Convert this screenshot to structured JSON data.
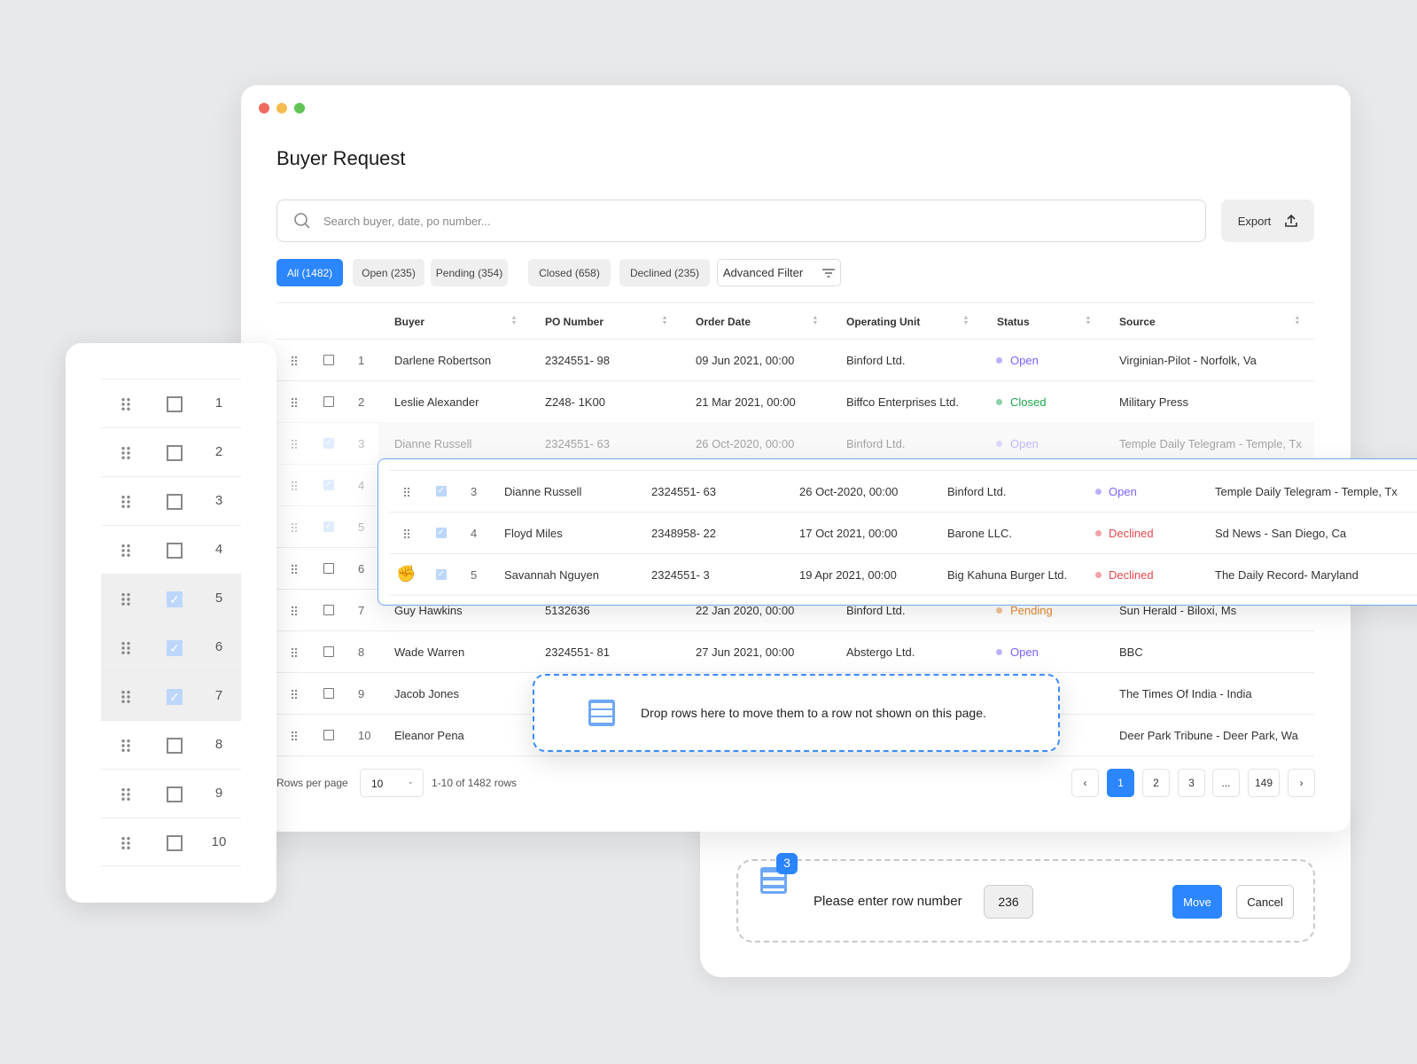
{
  "window": {
    "title": "Buyer Request",
    "traffic_colors": [
      "#ee6a5f",
      "#f5bd4f",
      "#61c454"
    ]
  },
  "search": {
    "placeholder": "Search buyer, date, po number..."
  },
  "export_label": "Export",
  "filters": [
    {
      "label": "All (1482)",
      "active": true
    },
    {
      "label": "Open (235)"
    },
    {
      "label": "Pending (354)"
    },
    {
      "label": "Closed (658)"
    },
    {
      "label": "Declined (235)"
    }
  ],
  "advanced_filter": "Advanced Filter",
  "columns": [
    "Buyer",
    "PO Number",
    "Order Date",
    "Operating Unit",
    "Status",
    "Source"
  ],
  "status_colors": {
    "Open": "#7b61ff",
    "Closed": "#1aa64a",
    "Declined": "#e5484d",
    "Pending": "#e08a2e"
  },
  "rows": [
    {
      "n": "1",
      "buyer": "Darlene Robertson",
      "po": "2324551- 98",
      "date": "09 Jun 2021, 00:00",
      "unit": "Binford Ltd.",
      "status": "Open",
      "source": "Virginian-Pilot - Norfolk, Va",
      "checked": false
    },
    {
      "n": "2",
      "buyer": "Leslie Alexander",
      "po": "Z248- 1K00",
      "date": "21 Mar 2021, 00:00",
      "unit": "Biffco Enterprises Ltd.",
      "status": "Closed",
      "source": "Military Press",
      "checked": false
    },
    {
      "n": "3",
      "buyer": "Dianne Russell",
      "po": "2324551- 63",
      "date": "26 Oct-2020, 00:00",
      "unit": "Binford Ltd.",
      "status": "Open",
      "source": "Temple Daily Telegram - Temple, Tx",
      "checked": true
    },
    {
      "n": "4",
      "checked": true
    },
    {
      "n": "5",
      "checked": true
    },
    {
      "n": "6",
      "checked": false
    },
    {
      "n": "7",
      "buyer": "Guy Hawkins",
      "po": "5132636",
      "date": "22 Jan 2020, 00:00",
      "unit": "Binford Ltd.",
      "status": "Pending",
      "source": "Sun Herald - Biloxi, Ms",
      "checked": false
    },
    {
      "n": "8",
      "buyer": "Wade Warren",
      "po": "2324551- 81",
      "date": "27 Jun 2021, 00:00",
      "unit": "Abstergo Ltd.",
      "status": "Open",
      "source": "BBC",
      "checked": false
    },
    {
      "n": "9",
      "buyer": "Jacob Jones",
      "source": "The Times Of India - India",
      "checked": false
    },
    {
      "n": "10",
      "buyer": "Eleanor Pena",
      "source": "Deer Park Tribune - Deer Park, Wa",
      "checked": false
    }
  ],
  "dragged_rows": [
    {
      "n": "3",
      "buyer": "Dianne Russell",
      "po": "2324551- 63",
      "date": "26 Oct-2020, 00:00",
      "unit": "Binford Ltd.",
      "status": "Open",
      "source": "Temple Daily Telegram - Temple, Tx"
    },
    {
      "n": "4",
      "buyer": "Floyd Miles",
      "po": "2348958- 22",
      "date": "17 Oct 2021, 00:00",
      "unit": "Barone LLC.",
      "status": "Declined",
      "source": "Sd News - San Diego, Ca"
    },
    {
      "n": "5",
      "buyer": "Savannah Nguyen",
      "po": "2324551- 3",
      "date": "19 Apr 2021, 00:00",
      "unit": "Big Kahuna Burger Ltd.",
      "status": "Declined",
      "source": "The Daily Record- Maryland"
    }
  ],
  "drop_zone": "Drop rows here to move them to a row not shown on this page.",
  "pagination": {
    "rows_per_page_label": "Rows per page",
    "rows_per_page": "10",
    "range": "1-10 of 1482 rows",
    "pages": [
      "1",
      "2",
      "3",
      "...",
      "149"
    ],
    "current": "1"
  },
  "left_panel": {
    "rows": [
      {
        "n": "1",
        "checked": false
      },
      {
        "n": "2",
        "checked": false
      },
      {
        "n": "3",
        "checked": false
      },
      {
        "n": "4",
        "checked": false
      },
      {
        "n": "5",
        "checked": true
      },
      {
        "n": "6",
        "checked": true
      },
      {
        "n": "7",
        "checked": true
      },
      {
        "n": "8",
        "checked": false
      },
      {
        "n": "9",
        "checked": false
      },
      {
        "n": "10",
        "checked": false
      }
    ]
  },
  "move_dialog": {
    "badge": "3",
    "label": "Please enter row number",
    "value": "236",
    "move": "Move",
    "cancel": "Cancel"
  },
  "accent": "#2b86ff"
}
